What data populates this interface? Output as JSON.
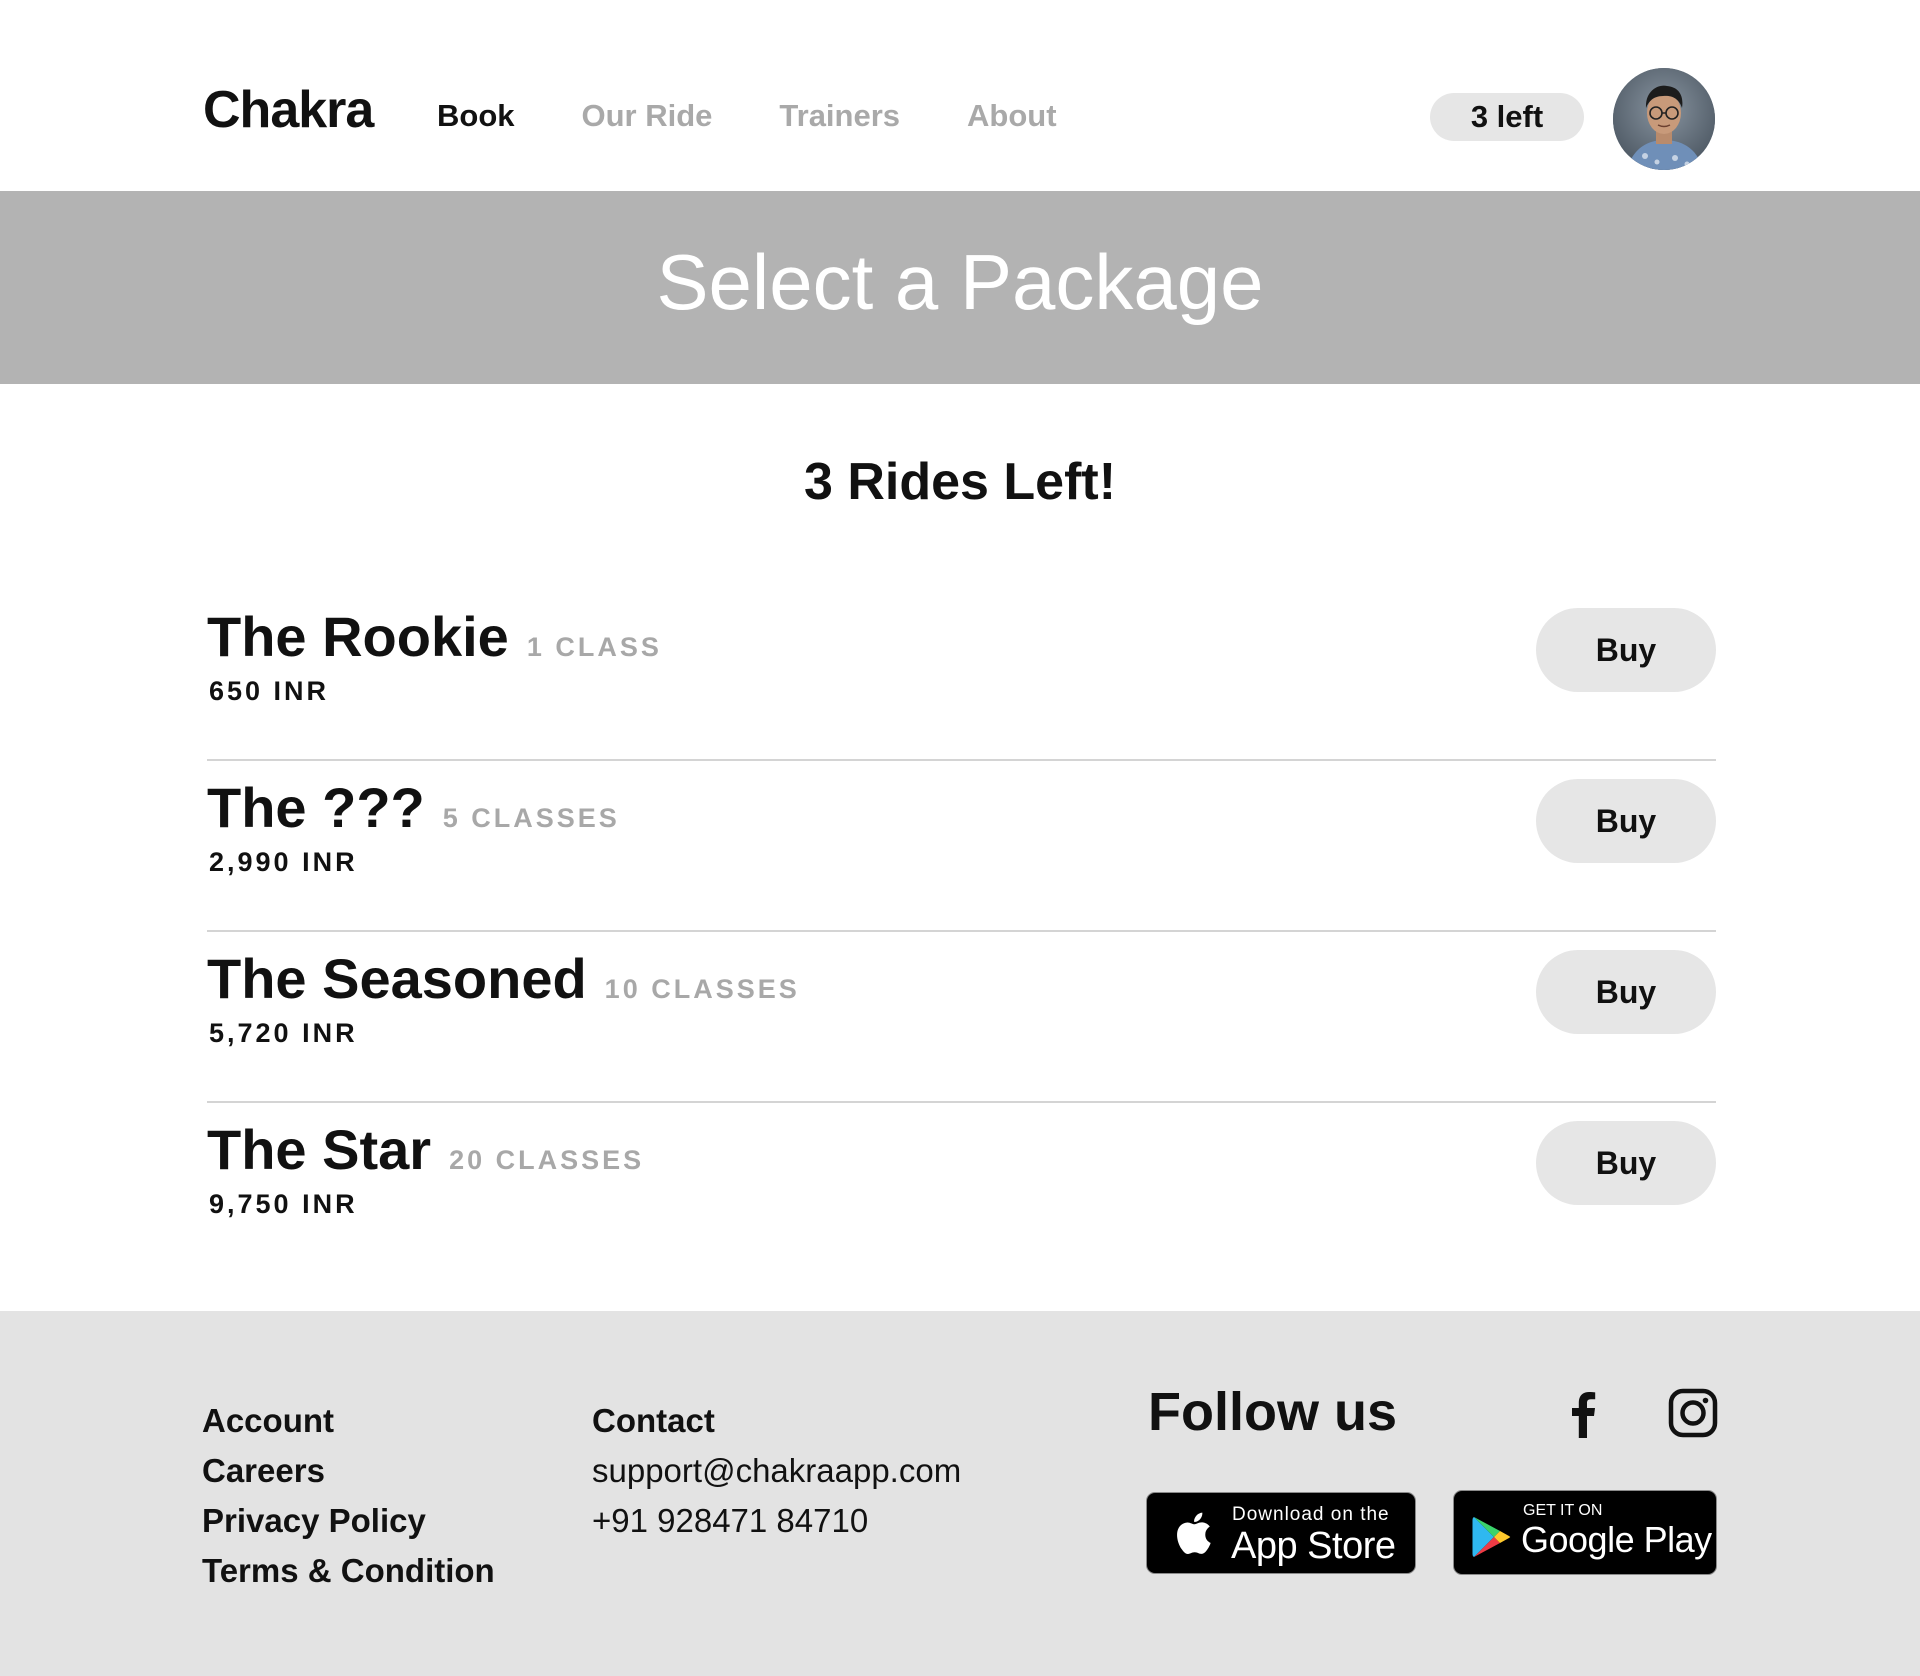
{
  "brand": {
    "logo": "Chakra"
  },
  "nav": {
    "items": [
      {
        "label": "Book",
        "active": true
      },
      {
        "label": "Our Ride",
        "active": false
      },
      {
        "label": "Trainers",
        "active": false
      },
      {
        "label": "About",
        "active": false
      }
    ]
  },
  "account": {
    "rides_badge": "3 left",
    "avatar_icon": "user-avatar"
  },
  "banner": {
    "title": "Select a Package"
  },
  "main": {
    "subtitle": "3 Rides Left!",
    "packages": [
      {
        "name": "The Rookie",
        "count": "1 CLASS",
        "price": "650 INR",
        "button": "Buy"
      },
      {
        "name": "The ???",
        "count": "5 CLASSES",
        "price": "2,990 INR",
        "button": "Buy"
      },
      {
        "name": "The Seasoned",
        "count": "10 CLASSES",
        "price": "5,720 INR",
        "button": "Buy"
      },
      {
        "name": "The Star",
        "count": "20 CLASSES",
        "price": "9,750 INR",
        "button": "Buy"
      }
    ]
  },
  "footer": {
    "links": [
      "Account",
      "Careers",
      "Privacy Policy",
      "Terms & Condition"
    ],
    "contact": {
      "heading": "Contact",
      "email": "support@chakraapp.com",
      "phone": "+91 928471 84710"
    },
    "follow": {
      "heading": "Follow us",
      "icons": [
        "facebook-icon",
        "instagram-icon"
      ]
    },
    "stores": {
      "apple": {
        "small": "Download on the",
        "big": "App Store"
      },
      "google": {
        "small": "GET IT ON",
        "big": "Google Play"
      }
    }
  },
  "colors": {
    "banner": "#b3b3b3",
    "footer": "#e3e3e3",
    "pill": "#e6e6e6",
    "muted_text": "#a8a8a8"
  }
}
